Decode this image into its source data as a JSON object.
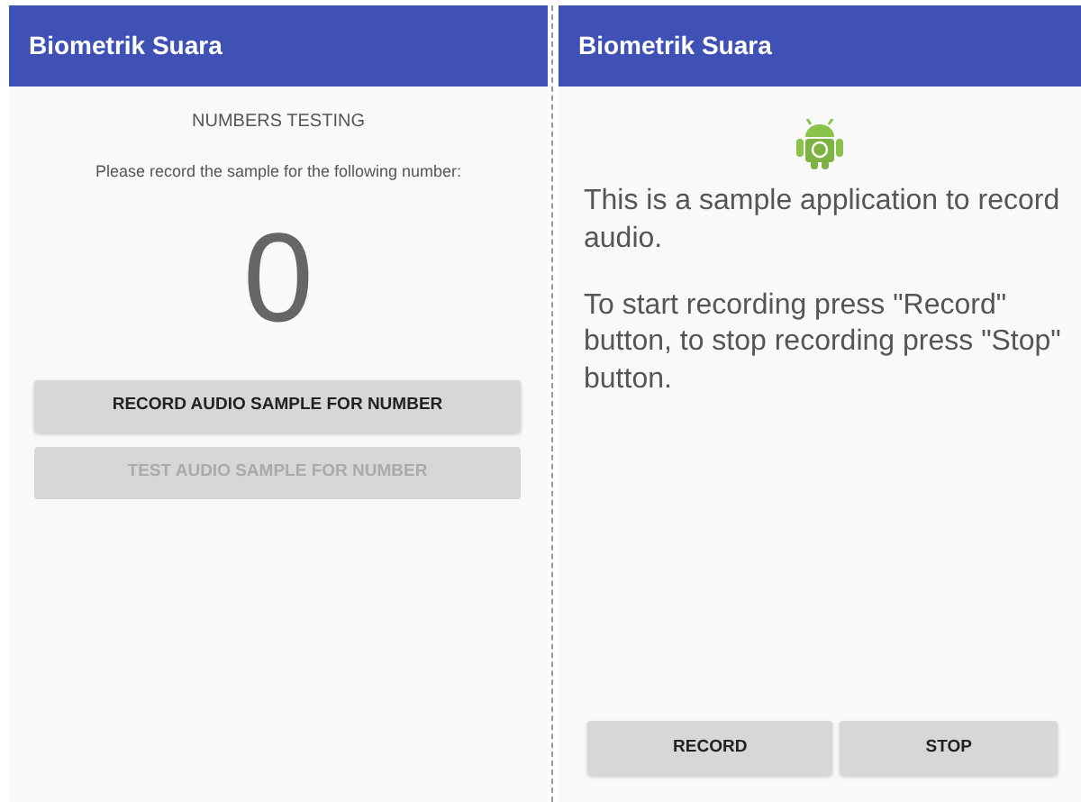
{
  "screens": [
    {
      "title": "Biometrik Suara",
      "heading": "NUMBERS TESTING",
      "instruction": "Please record the sample for the following number:",
      "number": "0",
      "buttons": [
        {
          "label": "RECORD AUDIO SAMPLE FOR NUMBER",
          "disabled": false
        },
        {
          "label": "TEST AUDIO SAMPLE FOR NUMBER",
          "disabled": true
        }
      ]
    },
    {
      "title": "Biometrik Suara",
      "paragraphs": [
        "This is a sample application to record audio.",
        "To start recording press \"Record\" button, to stop recording press \"Stop\" button."
      ],
      "buttons": [
        {
          "label": "RECORD",
          "disabled": false
        },
        {
          "label": "STOP",
          "disabled": false
        }
      ]
    }
  ]
}
